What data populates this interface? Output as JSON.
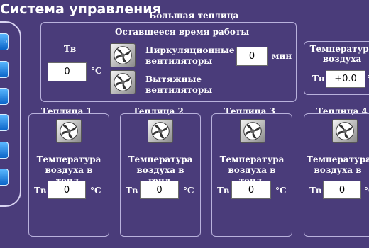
{
  "app": {
    "title": "Система управления"
  },
  "nav": {
    "first_button_label": "о"
  },
  "big_greenhouse": {
    "title": "Большая теплица",
    "remaining_time_label": "Оставшееся время работы",
    "temp_label": "Тв",
    "temp_value": "0",
    "temp_unit": "°С",
    "circ_fans_label": "Циркуляционные вентиляторы",
    "exhaust_fans_label": "Вытяжные вентиляторы",
    "minutes_value": "0",
    "minutes_unit": "мин"
  },
  "outdoor": {
    "title": "Температура воздуха снаружи",
    "label": "Тн",
    "value": "+0.0",
    "unit": "°С"
  },
  "greenhouses": [
    {
      "title": "Теплица 1",
      "temp_title": "Температура воздуха в тепл.",
      "label": "Тв",
      "value": "0",
      "unit": "°С"
    },
    {
      "title": "Теплица 2",
      "temp_title": "Температура воздуха в тепл.",
      "label": "Тв",
      "value": "0",
      "unit": "°С"
    },
    {
      "title": "Теплица 3",
      "temp_title": "Температура воздуха в тепл.",
      "label": "Тв",
      "value": "0",
      "unit": "°С"
    },
    {
      "title": "Теплица 4",
      "temp_title": "Температура воздуха в тепл.",
      "label": "Тв",
      "value": "0",
      "unit": "°С"
    }
  ],
  "colors": {
    "background": "#4a3c7a",
    "panel_border": "#b9b2dc",
    "nav_button": "#1a7fe0"
  }
}
